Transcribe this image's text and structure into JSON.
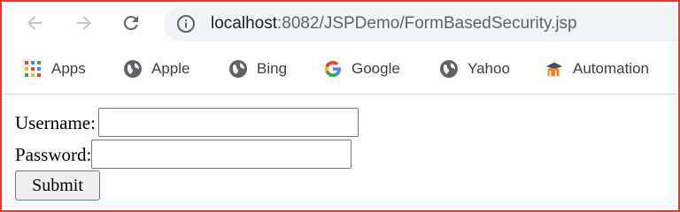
{
  "browser": {
    "url_host": "localhost",
    "url_rest": ":8082/JSPDemo/FormBasedSecurity.jsp",
    "icons": {
      "back": "arrow-left-icon",
      "forward": "arrow-right-icon",
      "reload": "reload-icon",
      "site_info": "info-icon"
    }
  },
  "bookmarks": [
    {
      "label": "Apps",
      "icon": "apps-grid-icon"
    },
    {
      "label": "Apple",
      "icon": "globe-icon"
    },
    {
      "label": "Bing",
      "icon": "globe-icon"
    },
    {
      "label": "Google",
      "icon": "google-g-icon"
    },
    {
      "label": "Yahoo",
      "icon": "globe-icon"
    },
    {
      "label": "Automation",
      "icon": "moodle-icon"
    }
  ],
  "form": {
    "username_label": "Username:",
    "username_value": "",
    "password_label": "Password:",
    "password_value": "",
    "submit_label": "Submit"
  },
  "colors": {
    "frame_border": "#e53935",
    "omnibox_bg": "#f1f3f4",
    "icon_gray": "#5f6368"
  }
}
